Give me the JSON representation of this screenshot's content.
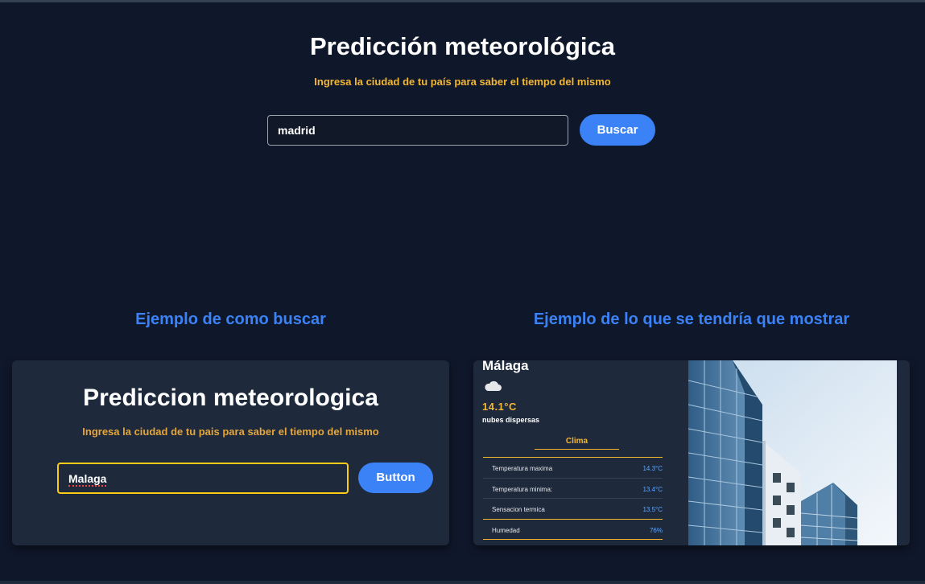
{
  "header": {
    "title": "Predicción meteorológica",
    "subtitle": "Ingresa la ciudad de tu país para saber el tiempo del mismo"
  },
  "search": {
    "value": "madrid",
    "button_label": "Buscar"
  },
  "examples": {
    "search_heading": "Ejemplo de como buscar",
    "result_heading": "Ejemplo de lo que se tendría que mostrar",
    "search_example": {
      "title": "Prediccion meteorologica",
      "subtitle": "Ingresa la ciudad de tu pais para saber el tiempo del mismo",
      "input_value": "Malaga",
      "button_label": "Button"
    },
    "result_example": {
      "city": "Málaga",
      "icon": "cloud-icon",
      "temperature": "14.1°C",
      "description": "nubes dispersas",
      "section_label": "Clima",
      "rows": [
        {
          "label": "Temperatura maxima",
          "value": "14.3°C"
        },
        {
          "label": "Temperatura minima:",
          "value": "13.4°C"
        },
        {
          "label": "Sensacion termica",
          "value": "13.5°C"
        },
        {
          "label": "Humedad",
          "value": "76%"
        }
      ]
    }
  },
  "colors": {
    "background": "#0f172a",
    "card": "#1e293b",
    "accent_blue": "#3b82f6",
    "accent_yellow": "#f4b732"
  }
}
